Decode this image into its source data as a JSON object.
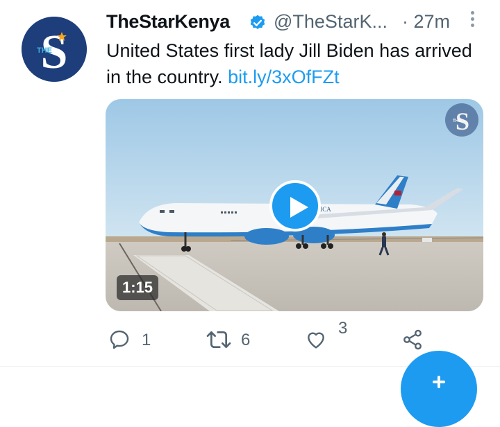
{
  "tweet": {
    "author_name": "TheStarKenya",
    "handle": "@TheStarK...",
    "separator_time": "· 27m",
    "text": "United States first lady Jill Biden has arrived in the country.",
    "link": "bit.ly/3xOfFZt",
    "avatar_letter": "S",
    "avatar_small": "THE"
  },
  "media": {
    "duration": "1:15",
    "watermark_letter": "S",
    "watermark_small": "THE",
    "plane_lettering": "OF AMERICA"
  },
  "actions": {
    "reply_count": "1",
    "retweet_count": "6",
    "like_count": "3"
  },
  "colors": {
    "accent": "#1d9bf0",
    "secondary_text": "#536471",
    "avatar_bg": "#1e3d7b"
  }
}
